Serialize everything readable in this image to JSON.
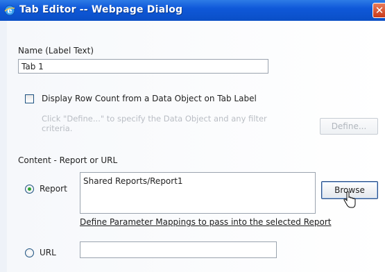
{
  "window": {
    "title": "Tab Editor -- Webpage Dialog",
    "close_glyph": "✕",
    "icon": "ie-icon"
  },
  "form": {
    "name_label": "Name (Label Text)",
    "name_value": "Tab 1",
    "rowcount_label": "Display Row Count from a Data Object on Tab Label",
    "rowcount_checked": false,
    "rowcount_hint": "Click \"Define...\" to specify the Data Object and any filter criteria.",
    "define_button": "Define...",
    "content_label": "Content - Report or URL",
    "report_option": "Report",
    "report_selected": true,
    "report_value": "Shared Reports/Report1",
    "browse_button": "Browse",
    "param_link": "Define Parameter Mappings to pass into the selected Report",
    "url_option": "URL",
    "url_value": ""
  },
  "colors": {
    "titlebar": "#0f58d9",
    "close": "#c8391a",
    "radio_selected": "#2fa531"
  }
}
